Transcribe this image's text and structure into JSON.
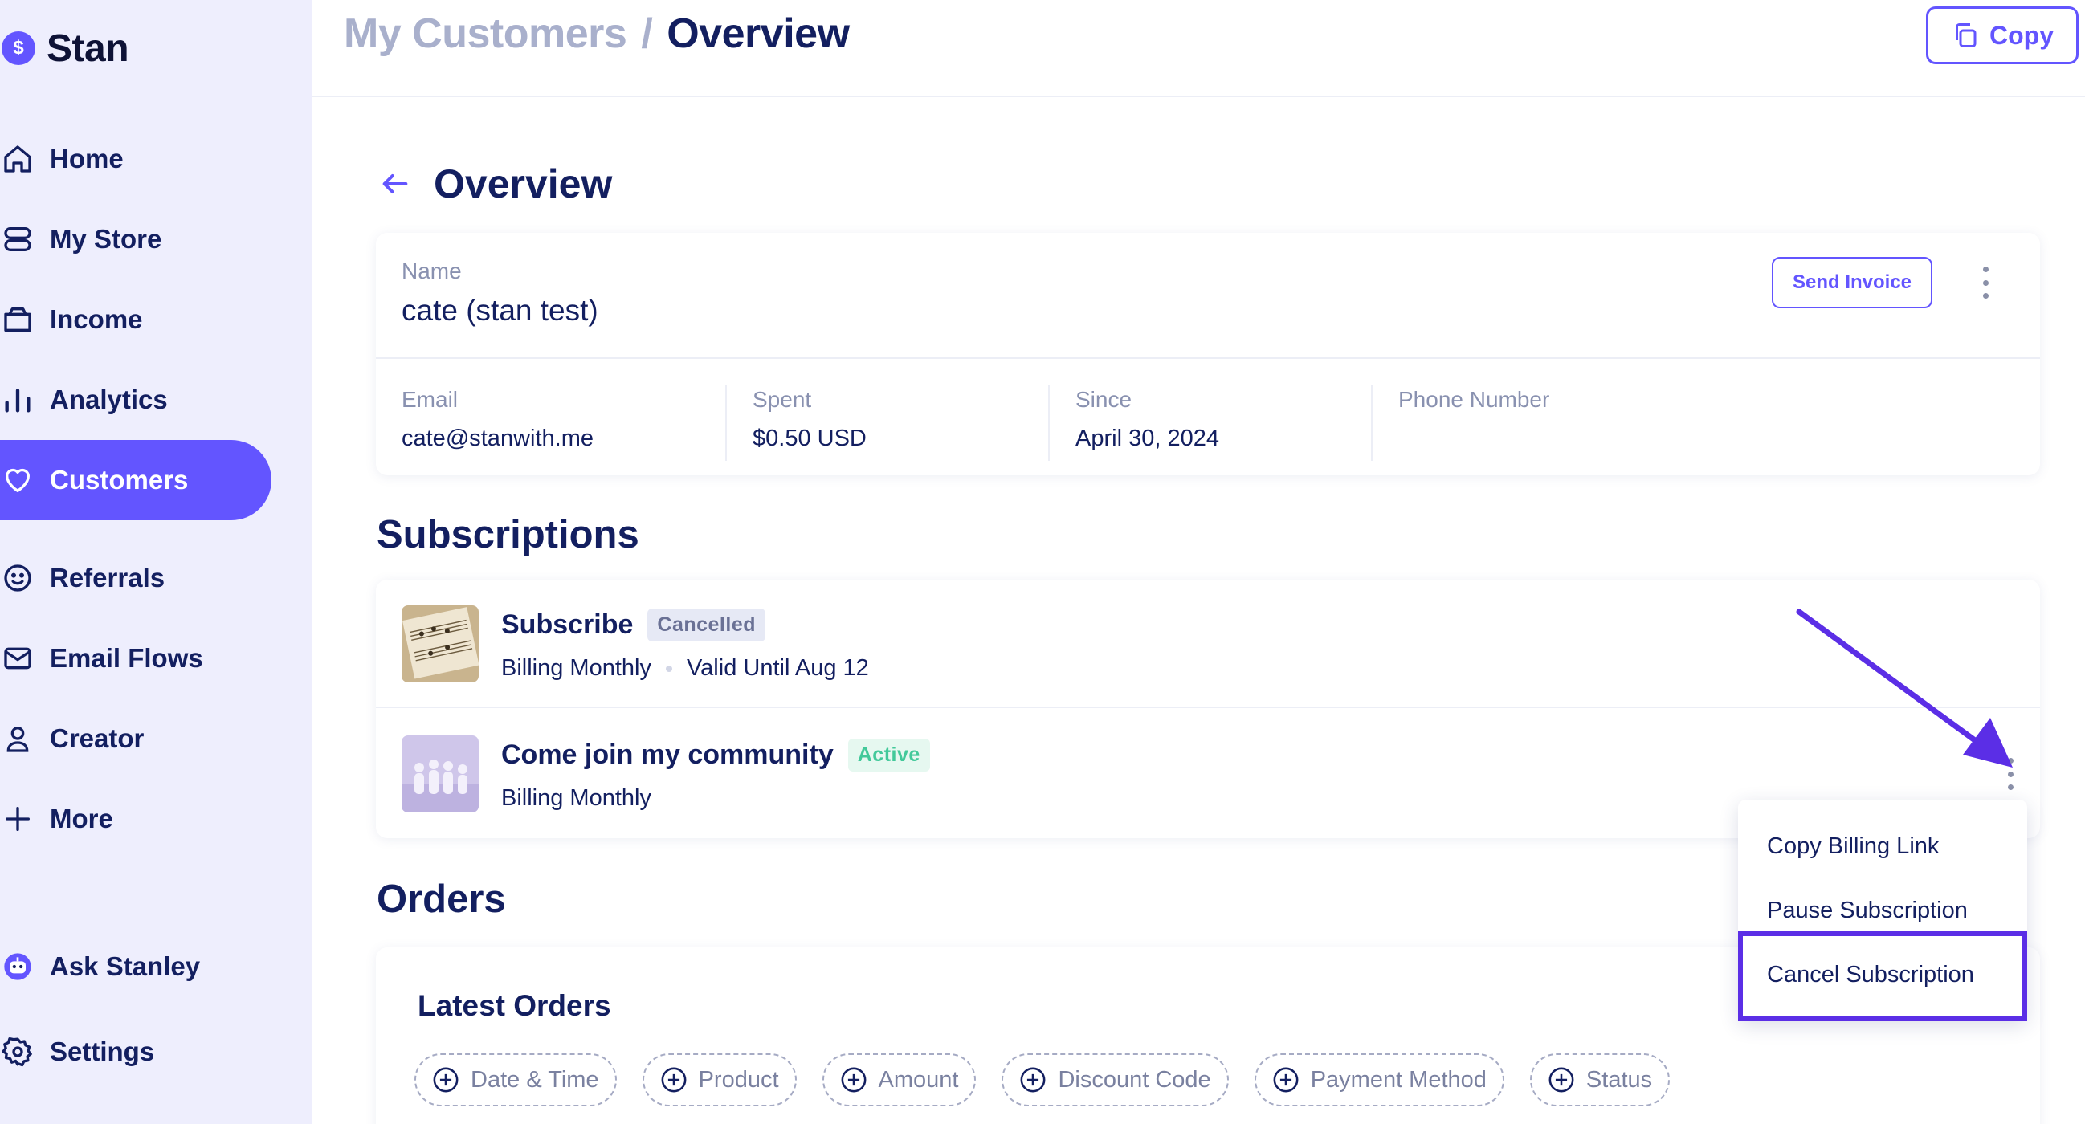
{
  "brand": {
    "name": "Stan",
    "logo_glyph": "$",
    "color": "#6355FF"
  },
  "sidebar": {
    "items": [
      {
        "label": "Home",
        "icon": "home-icon"
      },
      {
        "label": "My Store",
        "icon": "store-icon"
      },
      {
        "label": "Income",
        "icon": "wallet-icon"
      },
      {
        "label": "Analytics",
        "icon": "bar-chart-icon"
      },
      {
        "label": "Customers",
        "icon": "heart-icon",
        "active": true
      },
      {
        "label": "Referrals",
        "icon": "smile-icon"
      },
      {
        "label": "Email Flows",
        "icon": "mail-icon"
      },
      {
        "label": "Creator",
        "icon": "user-icon"
      },
      {
        "label": "More",
        "icon": "plus-icon"
      },
      {
        "label": "Ask Stanley",
        "icon": "stanley-bot-icon"
      },
      {
        "label": "Settings",
        "icon": "gear-icon"
      }
    ]
  },
  "header": {
    "breadcrumb_parent": "My Customers",
    "breadcrumb_separator": "/",
    "breadcrumb_current": "Overview",
    "copy_label": "Copy"
  },
  "overview": {
    "title": "Overview",
    "name_label": "Name",
    "name_value": "cate (stan test)",
    "send_invoice_label": "Send Invoice",
    "fields": [
      {
        "label": "Email",
        "value": "cate@stanwith.me"
      },
      {
        "label": "Spent",
        "value": "$0.50 USD"
      },
      {
        "label": "Since",
        "value": "April 30, 2024"
      },
      {
        "label": "Phone Number",
        "value": ""
      }
    ]
  },
  "subscriptions": {
    "title": "Subscriptions",
    "items": [
      {
        "name": "Subscribe",
        "status": "Cancelled",
        "billing": "Billing Monthly",
        "valid_until": "Valid Until Aug 12"
      },
      {
        "name": "Come join my community",
        "status": "Active",
        "billing": "Billing Monthly"
      }
    ]
  },
  "orders": {
    "title": "Orders",
    "card_title": "Latest Orders",
    "filters": [
      "Date & Time",
      "Product",
      "Amount",
      "Discount Code",
      "Payment Method",
      "Status"
    ]
  },
  "dropdown": {
    "items": [
      "Copy Billing Link",
      "Pause Subscription",
      "Cancel Subscription"
    ],
    "highlighted": "Cancel Subscription",
    "highlight_color": "#5B2EE6"
  },
  "colors": {
    "accent": "#6355FF",
    "text": "#131F60",
    "muted": "#8991B0",
    "sidebar_bg": "#EEEEFD",
    "active_badge": "#42C99A"
  }
}
